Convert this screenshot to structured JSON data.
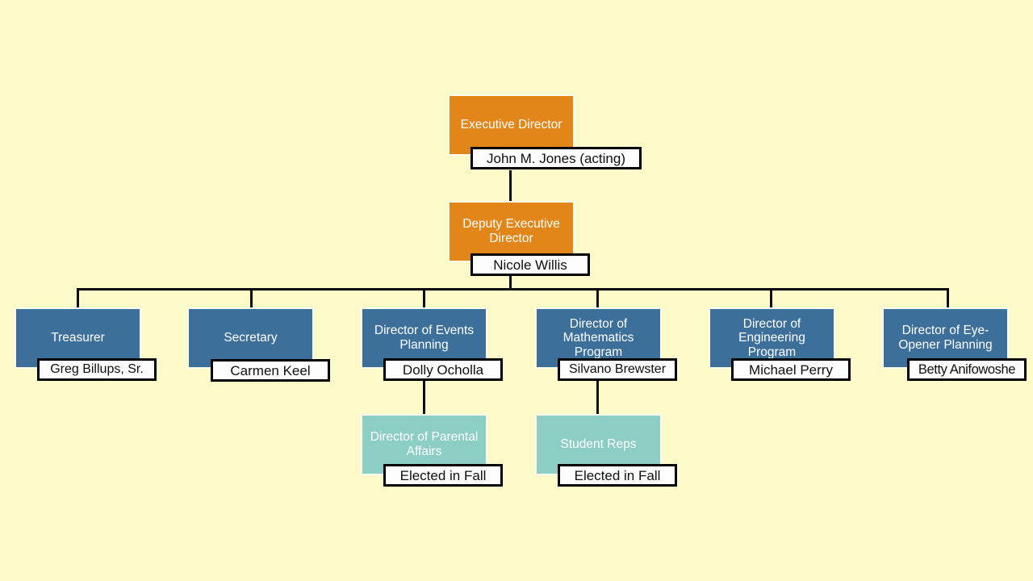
{
  "page": {
    "title": "Organizational Chart",
    "background_color": "#fcfac8",
    "colors": {
      "executive_level": "#e3861a",
      "director_level": "#3d6f9b",
      "subcommittee_level": "#8ccec4",
      "connector": "#0d0d0d",
      "plate_fill": "#fdfdfd",
      "plate_border": "#000000",
      "role_text": "#ffffff",
      "name_text": "#101010"
    }
  },
  "nodes": {
    "executive_director": {
      "role": "Executive Director",
      "name": "John M. Jones (acting)",
      "level": "executive"
    },
    "deputy_executive_director": {
      "role": "Deputy Executive Director",
      "name": "Nicole Willis",
      "level": "executive"
    },
    "treasurer": {
      "role": "Treasurer",
      "name": "Greg Billups, Sr.",
      "level": "director"
    },
    "secretary": {
      "role": "Secretary",
      "name": "Carmen Keel",
      "level": "director"
    },
    "events_planning": {
      "role": "Director of Events Planning",
      "name": "Dolly Ocholla",
      "level": "director"
    },
    "mathematics_program": {
      "role": "Director of Mathematics Program",
      "name": "Silvano Brewster",
      "level": "director"
    },
    "engineering_program": {
      "role": "Director of Engineering Program",
      "name": "Michael Perry",
      "level": "director"
    },
    "eye_opener_planning": {
      "role": "Director of Eye-Opener Planning",
      "name": "Betty Anifowoshe",
      "level": "director"
    },
    "parental_affairs": {
      "role": "Director of Parental Affairs",
      "name": "Elected in Fall",
      "level": "subcommittee"
    },
    "student_reps": {
      "role": "Student Reps",
      "name": "Elected in Fall",
      "level": "subcommittee"
    }
  }
}
